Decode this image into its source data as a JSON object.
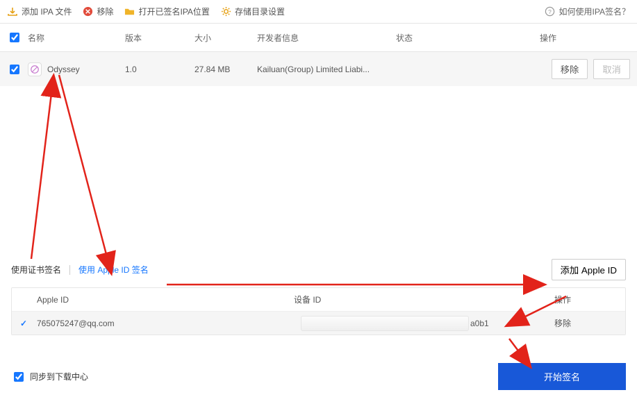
{
  "toolbar": {
    "add_ipa": "添加 IPA 文件",
    "remove": "移除",
    "open_signed_location": "打开已签名IPA位置",
    "storage_settings": "存储目录设置",
    "help": "如何使用IPA签名？"
  },
  "columns": {
    "name": "名称",
    "version": "版本",
    "size": "大小",
    "developer": "开发者信息",
    "state": "状态",
    "ops": "操作"
  },
  "row": {
    "app_name": "Odyssey",
    "version": "1.0",
    "size": "27.84 MB",
    "developer": "Kailuan(Group) Limited Liabi...",
    "state": "",
    "remove": "移除",
    "cancel": "取消"
  },
  "signing": {
    "tab_cert": "使用证书签名",
    "tab_appleid": "使用 Apple ID 签名",
    "add_appleid": "添加 Apple ID"
  },
  "id_columns": {
    "apple_id": "Apple ID",
    "device_id": "设备 ID",
    "ops": "操作"
  },
  "id_row": {
    "apple_id": "765075247@qq.com",
    "device_suffix": "a0b1",
    "remove": "移除"
  },
  "footer": {
    "sync": "同步到下载中心",
    "start": "开始签名"
  }
}
